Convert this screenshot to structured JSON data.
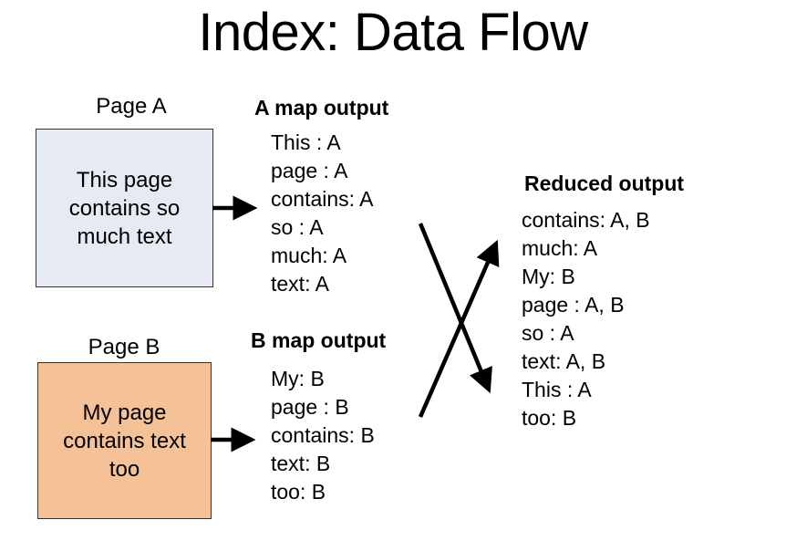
{
  "title": "Index: Data Flow",
  "page_a": {
    "label": "Page A",
    "text": "This page contains so much text"
  },
  "page_b": {
    "label": "Page B",
    "text": "My page contains text too"
  },
  "a_map": {
    "heading": "A map output",
    "items": [
      "This : A",
      "page : A",
      "contains: A",
      "so : A",
      "much: A",
      "text: A"
    ]
  },
  "b_map": {
    "heading": "B map output",
    "items": [
      "My: B",
      "page : B",
      "contains: B",
      "text: B",
      "too: B"
    ]
  },
  "reduced": {
    "heading": "Reduced output",
    "items": [
      "contains: A, B",
      "much: A",
      "My: B",
      "page : A, B",
      "so : A",
      "text: A, B",
      "This : A",
      "too: B"
    ]
  },
  "colors": {
    "page_a_fill": "#e6ebf3",
    "page_b_fill": "#f5c197",
    "arrow": "#000000"
  }
}
